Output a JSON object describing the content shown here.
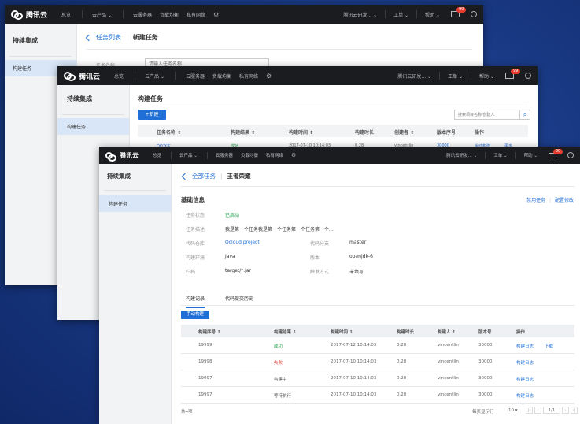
{
  "topbar": {
    "logo": "腾讯云",
    "nav": [
      "总览",
      "云产品",
      "云服务器",
      "负载均衡",
      "私有网络"
    ],
    "account": "腾讯云研发...",
    "ticket": "工单",
    "help": "帮助",
    "badge": "99"
  },
  "back_window": {
    "sidebar_title": "持续集成",
    "sidebar_item": "构建任务",
    "breadcrumb_parent": "任务列表",
    "breadcrumb_current": "新建任务",
    "field_label": "任务名称",
    "field_placeholder": "请输入任务名称"
  },
  "mid_window": {
    "sidebar_title": "持续集成",
    "sidebar_item": "构建任务",
    "page_title": "构建任务",
    "new_button": "+新建",
    "search_placeholder": "搜索项目名称/创建人",
    "columns": [
      "任务名称",
      "构建结果",
      "构建时间",
      "构建时长",
      "创建者",
      "版本序号",
      "操作"
    ],
    "row_partial": [
      "QQ飞车",
      "成功",
      "2017-07-10 10:14:03",
      "0.28",
      "vincentlin",
      "30000",
      "手动构建",
      "更多"
    ]
  },
  "front_window": {
    "sidebar_title": "持续集成",
    "sidebar_item": "构建任务",
    "breadcrumb_parent": "全部任务",
    "breadcrumb_current": "王者荣耀",
    "section_title": "基础信息",
    "actions": [
      "禁用任务",
      "配置修改"
    ],
    "info": {
      "status_label": "任务状态",
      "status_value": "已启动",
      "desc_label": "任务描述",
      "desc_value": "我是第一个任务我是第一个任务第一个任务第一个...",
      "repo_label": "代码仓库",
      "repo_value": "Qcloud project",
      "branch_label": "代码分支",
      "branch_value": "master",
      "env_label": "构建环境",
      "env_value": "Java",
      "version_label": "版本",
      "version_value": "openjdk-6",
      "artifact_label": "归档",
      "artifact_value": "target/*.jar",
      "trigger_label": "触发方式",
      "trigger_value": "未填写"
    },
    "tabs": [
      "构建记录",
      "代码提交历史"
    ],
    "manual_build_button": "手动构建",
    "columns": [
      "构建序号",
      "构建结果",
      "构建时间",
      "构建时长",
      "构建人",
      "版本号",
      "操作"
    ],
    "rows": [
      {
        "id": "19999",
        "result": "成功",
        "time": "2017-07-12 10:14:03",
        "duration": "0.28",
        "user": "vincentlin",
        "version": "30000",
        "op1": "构建日志",
        "op2": "下载"
      },
      {
        "id": "19998",
        "result": "失败",
        "time": "2017-07-10 10:14:03",
        "duration": "0.28",
        "user": "vincentlin",
        "version": "30000",
        "op1": "构建日志",
        "op2": ""
      },
      {
        "id": "19997",
        "result": "构建中",
        "time": "2017-07-10 10:14:03",
        "duration": "0.28",
        "user": "vincentlin",
        "version": "30000",
        "op1": "构建日志",
        "op2": ""
      },
      {
        "id": "19997",
        "result": "等待执行",
        "time": "2017-07-10 10:14:03",
        "duration": "0.28",
        "user": "vincentlin",
        "version": "30000",
        "op1": "构建日志",
        "op2": ""
      }
    ],
    "footer_total": "共4项",
    "page_size_label": "每页显示行",
    "page_size": "10",
    "pager": "1/1"
  },
  "colors": {
    "accent": "#1f6fd6",
    "success": "#22a34a",
    "danger": "#e03b2e",
    "topbar": "#1b1c1f"
  }
}
